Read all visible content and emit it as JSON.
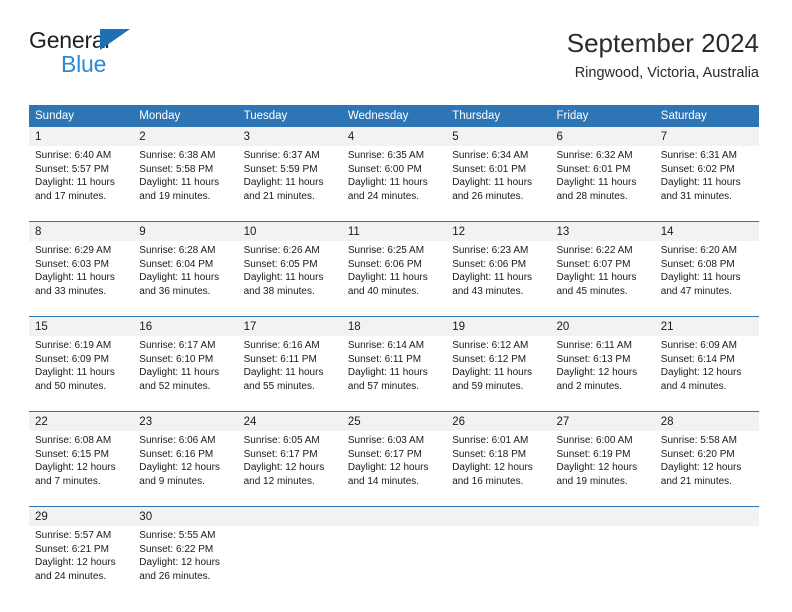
{
  "logo": {
    "word_top": "General",
    "word_bottom": "Blue",
    "triangle_color": "#1f6fb5",
    "blue_text_color": "#2b8ad6"
  },
  "header": {
    "title": "September 2024",
    "subtitle": "Ringwood, Victoria, Australia"
  },
  "colors": {
    "header_blue": "#2e75b6",
    "daynum_background": "#f2f2f2",
    "separator_blue": "#2e75b6",
    "text": "#1a1a1a"
  },
  "weekday_headers": [
    "Sunday",
    "Monday",
    "Tuesday",
    "Wednesday",
    "Thursday",
    "Friday",
    "Saturday"
  ],
  "weeks": [
    {
      "days": [
        {
          "date": "1",
          "sunrise": "Sunrise: 6:40 AM",
          "sunset": "Sunset: 5:57 PM",
          "daylight_1": "Daylight: 11 hours",
          "daylight_2": "and 17 minutes."
        },
        {
          "date": "2",
          "sunrise": "Sunrise: 6:38 AM",
          "sunset": "Sunset: 5:58 PM",
          "daylight_1": "Daylight: 11 hours",
          "daylight_2": "and 19 minutes."
        },
        {
          "date": "3",
          "sunrise": "Sunrise: 6:37 AM",
          "sunset": "Sunset: 5:59 PM",
          "daylight_1": "Daylight: 11 hours",
          "daylight_2": "and 21 minutes."
        },
        {
          "date": "4",
          "sunrise": "Sunrise: 6:35 AM",
          "sunset": "Sunset: 6:00 PM",
          "daylight_1": "Daylight: 11 hours",
          "daylight_2": "and 24 minutes."
        },
        {
          "date": "5",
          "sunrise": "Sunrise: 6:34 AM",
          "sunset": "Sunset: 6:01 PM",
          "daylight_1": "Daylight: 11 hours",
          "daylight_2": "and 26 minutes."
        },
        {
          "date": "6",
          "sunrise": "Sunrise: 6:32 AM",
          "sunset": "Sunset: 6:01 PM",
          "daylight_1": "Daylight: 11 hours",
          "daylight_2": "and 28 minutes."
        },
        {
          "date": "7",
          "sunrise": "Sunrise: 6:31 AM",
          "sunset": "Sunset: 6:02 PM",
          "daylight_1": "Daylight: 11 hours",
          "daylight_2": "and 31 minutes."
        }
      ]
    },
    {
      "days": [
        {
          "date": "8",
          "sunrise": "Sunrise: 6:29 AM",
          "sunset": "Sunset: 6:03 PM",
          "daylight_1": "Daylight: 11 hours",
          "daylight_2": "and 33 minutes."
        },
        {
          "date": "9",
          "sunrise": "Sunrise: 6:28 AM",
          "sunset": "Sunset: 6:04 PM",
          "daylight_1": "Daylight: 11 hours",
          "daylight_2": "and 36 minutes."
        },
        {
          "date": "10",
          "sunrise": "Sunrise: 6:26 AM",
          "sunset": "Sunset: 6:05 PM",
          "daylight_1": "Daylight: 11 hours",
          "daylight_2": "and 38 minutes."
        },
        {
          "date": "11",
          "sunrise": "Sunrise: 6:25 AM",
          "sunset": "Sunset: 6:06 PM",
          "daylight_1": "Daylight: 11 hours",
          "daylight_2": "and 40 minutes."
        },
        {
          "date": "12",
          "sunrise": "Sunrise: 6:23 AM",
          "sunset": "Sunset: 6:06 PM",
          "daylight_1": "Daylight: 11 hours",
          "daylight_2": "and 43 minutes."
        },
        {
          "date": "13",
          "sunrise": "Sunrise: 6:22 AM",
          "sunset": "Sunset: 6:07 PM",
          "daylight_1": "Daylight: 11 hours",
          "daylight_2": "and 45 minutes."
        },
        {
          "date": "14",
          "sunrise": "Sunrise: 6:20 AM",
          "sunset": "Sunset: 6:08 PM",
          "daylight_1": "Daylight: 11 hours",
          "daylight_2": "and 47 minutes."
        }
      ]
    },
    {
      "days": [
        {
          "date": "15",
          "sunrise": "Sunrise: 6:19 AM",
          "sunset": "Sunset: 6:09 PM",
          "daylight_1": "Daylight: 11 hours",
          "daylight_2": "and 50 minutes."
        },
        {
          "date": "16",
          "sunrise": "Sunrise: 6:17 AM",
          "sunset": "Sunset: 6:10 PM",
          "daylight_1": "Daylight: 11 hours",
          "daylight_2": "and 52 minutes."
        },
        {
          "date": "17",
          "sunrise": "Sunrise: 6:16 AM",
          "sunset": "Sunset: 6:11 PM",
          "daylight_1": "Daylight: 11 hours",
          "daylight_2": "and 55 minutes."
        },
        {
          "date": "18",
          "sunrise": "Sunrise: 6:14 AM",
          "sunset": "Sunset: 6:11 PM",
          "daylight_1": "Daylight: 11 hours",
          "daylight_2": "and 57 minutes."
        },
        {
          "date": "19",
          "sunrise": "Sunrise: 6:12 AM",
          "sunset": "Sunset: 6:12 PM",
          "daylight_1": "Daylight: 11 hours",
          "daylight_2": "and 59 minutes."
        },
        {
          "date": "20",
          "sunrise": "Sunrise: 6:11 AM",
          "sunset": "Sunset: 6:13 PM",
          "daylight_1": "Daylight: 12 hours",
          "daylight_2": "and 2 minutes."
        },
        {
          "date": "21",
          "sunrise": "Sunrise: 6:09 AM",
          "sunset": "Sunset: 6:14 PM",
          "daylight_1": "Daylight: 12 hours",
          "daylight_2": "and 4 minutes."
        }
      ]
    },
    {
      "days": [
        {
          "date": "22",
          "sunrise": "Sunrise: 6:08 AM",
          "sunset": "Sunset: 6:15 PM",
          "daylight_1": "Daylight: 12 hours",
          "daylight_2": "and 7 minutes."
        },
        {
          "date": "23",
          "sunrise": "Sunrise: 6:06 AM",
          "sunset": "Sunset: 6:16 PM",
          "daylight_1": "Daylight: 12 hours",
          "daylight_2": "and 9 minutes."
        },
        {
          "date": "24",
          "sunrise": "Sunrise: 6:05 AM",
          "sunset": "Sunset: 6:17 PM",
          "daylight_1": "Daylight: 12 hours",
          "daylight_2": "and 12 minutes."
        },
        {
          "date": "25",
          "sunrise": "Sunrise: 6:03 AM",
          "sunset": "Sunset: 6:17 PM",
          "daylight_1": "Daylight: 12 hours",
          "daylight_2": "and 14 minutes."
        },
        {
          "date": "26",
          "sunrise": "Sunrise: 6:01 AM",
          "sunset": "Sunset: 6:18 PM",
          "daylight_1": "Daylight: 12 hours",
          "daylight_2": "and 16 minutes."
        },
        {
          "date": "27",
          "sunrise": "Sunrise: 6:00 AM",
          "sunset": "Sunset: 6:19 PM",
          "daylight_1": "Daylight: 12 hours",
          "daylight_2": "and 19 minutes."
        },
        {
          "date": "28",
          "sunrise": "Sunrise: 5:58 AM",
          "sunset": "Sunset: 6:20 PM",
          "daylight_1": "Daylight: 12 hours",
          "daylight_2": "and 21 minutes."
        }
      ]
    },
    {
      "days": [
        {
          "date": "29",
          "sunrise": "Sunrise: 5:57 AM",
          "sunset": "Sunset: 6:21 PM",
          "daylight_1": "Daylight: 12 hours",
          "daylight_2": "and 24 minutes."
        },
        {
          "date": "30",
          "sunrise": "Sunrise: 5:55 AM",
          "sunset": "Sunset: 6:22 PM",
          "daylight_1": "Daylight: 12 hours",
          "daylight_2": "and 26 minutes."
        },
        {
          "date": "",
          "sunrise": "",
          "sunset": "",
          "daylight_1": "",
          "daylight_2": ""
        },
        {
          "date": "",
          "sunrise": "",
          "sunset": "",
          "daylight_1": "",
          "daylight_2": ""
        },
        {
          "date": "",
          "sunrise": "",
          "sunset": "",
          "daylight_1": "",
          "daylight_2": ""
        },
        {
          "date": "",
          "sunrise": "",
          "sunset": "",
          "daylight_1": "",
          "daylight_2": ""
        },
        {
          "date": "",
          "sunrise": "",
          "sunset": "",
          "daylight_1": "",
          "daylight_2": ""
        }
      ]
    }
  ]
}
